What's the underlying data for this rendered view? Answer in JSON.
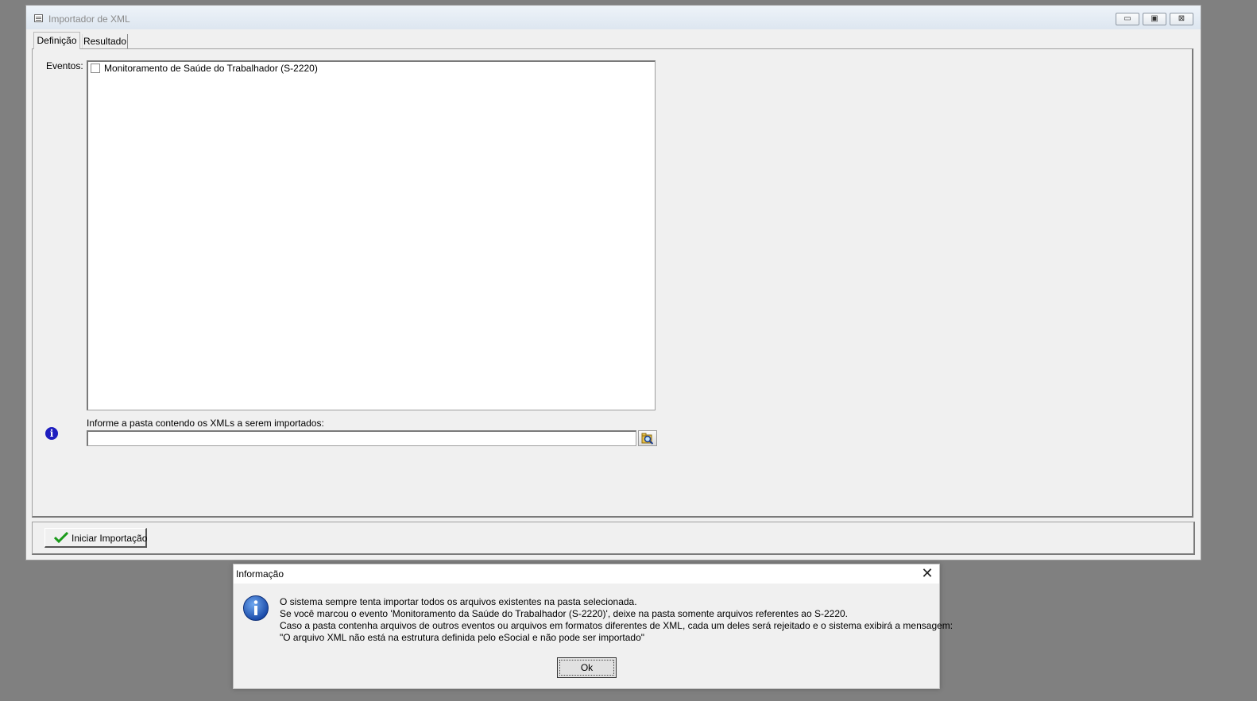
{
  "window": {
    "title": "Importador de XML",
    "controls": {
      "minimize": "▭",
      "maximize": "▣",
      "close": "⊠"
    }
  },
  "tabs": [
    {
      "label": "Definição",
      "active": true
    },
    {
      "label": "Resultado",
      "active": false
    }
  ],
  "definicao": {
    "eventos_label": "Eventos:",
    "eventos": [
      {
        "label": "Monitoramento de Saúde do Trabalhador (S-2220)",
        "checked": false
      }
    ],
    "pasta_label": "Informe a pasta contendo os XMLs a serem importados:",
    "pasta_value": "",
    "info_icon": "info-icon",
    "browse_icon": "folder-search-icon"
  },
  "footer": {
    "iniciar_label": "Iniciar Importação",
    "iniciar_icon": "green-check-icon"
  },
  "dialog": {
    "title": "Informação",
    "close_glyph": "✕",
    "icon": "information-icon",
    "lines": [
      "O sistema sempre tenta importar todos os arquivos existentes na pasta selecionada.",
      "Se você marcou o evento 'Monitoramento da Saúde do Trabalhador (S-2220)', deixe na pasta somente arquivos referentes ao S-2220.",
      "Caso a pasta contenha arquivos de outros eventos ou arquivos em formatos diferentes de XML, cada um deles será rejeitado e o sistema exibirá a mensagem:",
      "\"O arquivo XML não está na estrutura definida pelo eSocial e não pode ser importado\""
    ],
    "ok_label": "Ok"
  },
  "colors": {
    "desktop": "#808080",
    "window_bg": "#f0f0f0",
    "info_blue": "#1e1ebf",
    "check_green": "#1a9a1a"
  }
}
